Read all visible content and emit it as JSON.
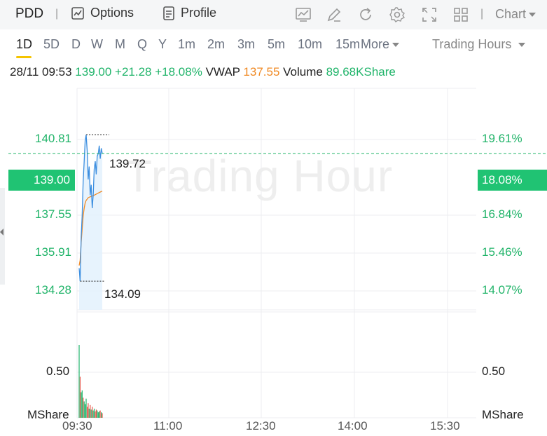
{
  "toolbar": {
    "ticker": "PDD",
    "options_label": "Options",
    "profile_label": "Profile",
    "chart_label": "Chart"
  },
  "tabs": [
    "1D",
    "5D",
    "D",
    "W",
    "M",
    "Q",
    "Y",
    "1m",
    "2m",
    "3m",
    "5m",
    "10m",
    "15m"
  ],
  "tabs_more": "More",
  "trading_hours_label": "Trading Hours",
  "info": {
    "datetime": "28/11 09:53",
    "price": "139.00",
    "change": "+21.28",
    "change_pct": "+18.08%",
    "vwap_label": "VWAP",
    "vwap": "137.55",
    "volume_label": "Volume",
    "volume": "89.68KShare"
  },
  "watermark": "Trading Hour",
  "axis_left": [
    "140.81",
    "137.55",
    "135.91",
    "134.28"
  ],
  "axis_right": [
    "19.61%",
    "16.84%",
    "15.46%",
    "14.07%"
  ],
  "current_price": "139.00",
  "current_pct": "18.08%",
  "high_label": "139.72",
  "low_label": "134.09",
  "volume_axis": {
    "value": "0.50",
    "unit": "MShare"
  },
  "time_axis": [
    "09:30",
    "11:00",
    "12:30",
    "14:00",
    "15:30"
  ],
  "colors": {
    "up": "#20b46a",
    "price_line": "#3d8fe0",
    "vwap_line": "#f08a24",
    "price_box": "#20c373",
    "active_tab_underline": "#f5c400"
  },
  "chart_data": {
    "type": "line",
    "price": [
      134.6,
      134.1,
      135.8,
      136.6,
      137.9,
      138.7,
      139.5,
      139.72,
      139.1,
      138.0,
      138.5,
      137.4,
      137.8,
      136.9,
      137.4,
      138.4,
      138.7,
      138.2,
      138.9,
      139.0,
      139.3,
      138.8,
      139.2,
      139.0
    ],
    "vwap": [
      134.7,
      134.9,
      135.6,
      136.1,
      136.6,
      136.9,
      137.1,
      137.2,
      137.25,
      137.3,
      137.32,
      137.34,
      137.35,
      137.37,
      137.38,
      137.4,
      137.42,
      137.44,
      137.46,
      137.48,
      137.5,
      137.52,
      137.54,
      137.55
    ],
    "volume": [
      0.8,
      0.45,
      0.28,
      0.3,
      0.22,
      0.18,
      0.15,
      0.21,
      0.12,
      0.16,
      0.1,
      0.14,
      0.09,
      0.12,
      0.08,
      0.1,
      0.07,
      0.09,
      0.08,
      0.06,
      0.07,
      0.08,
      0.06,
      0.05
    ],
    "volume_up": [
      true,
      false,
      true,
      true,
      false,
      true,
      true,
      true,
      false,
      false,
      true,
      false,
      true,
      false,
      true,
      true,
      false,
      false,
      true,
      true,
      true,
      false,
      true,
      false
    ],
    "ylim": [
      133.0,
      141.5
    ],
    "xlabel": "",
    "ylabel": ""
  }
}
